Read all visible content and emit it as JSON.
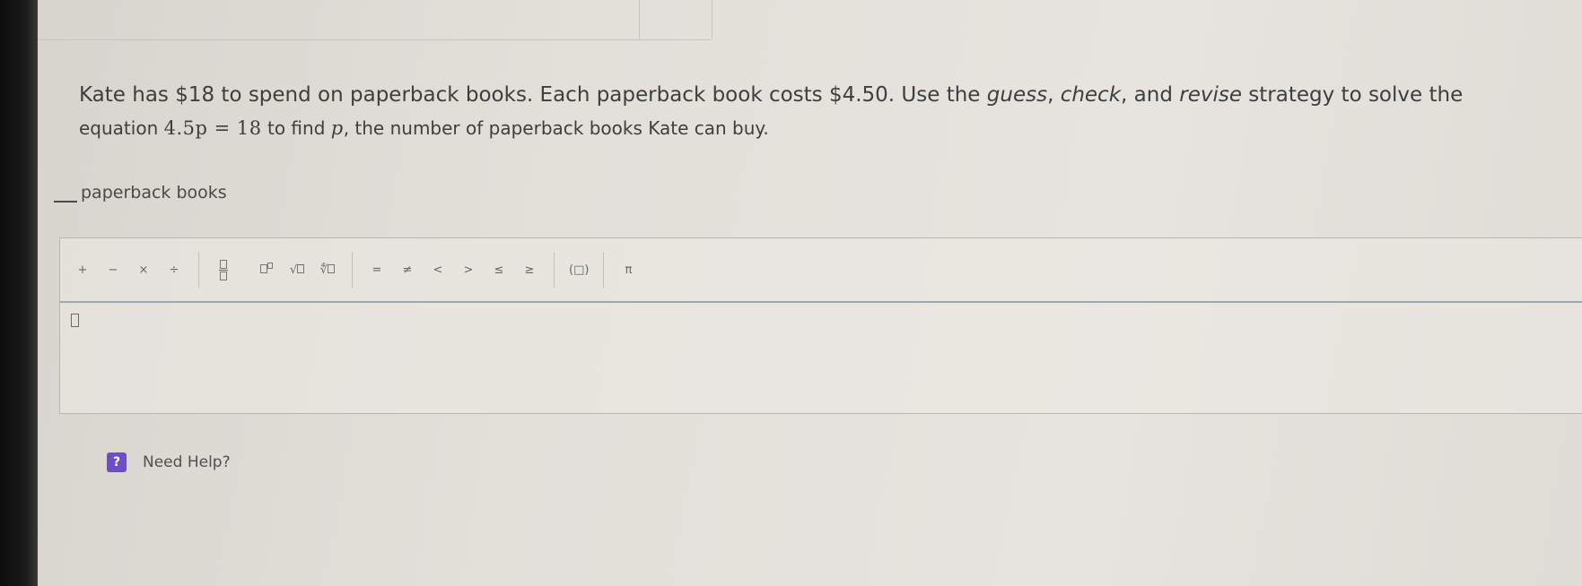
{
  "problem": {
    "text_1": "Kate has $18 to spend on paperback books. Each paperback book costs $4.50. Use the ",
    "strategy_1": "guess",
    "sep_1": ", ",
    "strategy_2": "check",
    "sep_2": ", and ",
    "strategy_3": "revise",
    "text_2": " strategy to solve the",
    "text_3": "equation ",
    "equation": "4.5p = 18",
    "text_4": " to find ",
    "variable": "p",
    "text_5": ", the number of paperback books Kate can buy."
  },
  "answer": {
    "suffix": "paperback books"
  },
  "toolbar": {
    "plus": "+",
    "minus": "−",
    "times": "×",
    "divide": "÷",
    "fraction": "fraction",
    "exponent": "exponent",
    "sqrt": "√",
    "nthroot": "∛",
    "equals": "=",
    "not_equal": "≠",
    "less": "<",
    "greater": ">",
    "less_equal": "≤",
    "greater_equal": "≥",
    "parens": "(□)",
    "pi": "π"
  },
  "help": {
    "icon": "?",
    "label": "Need Help?"
  },
  "colors": {
    "help_icon": "#6d4ec4",
    "editor_border": "#9fa7ad"
  }
}
